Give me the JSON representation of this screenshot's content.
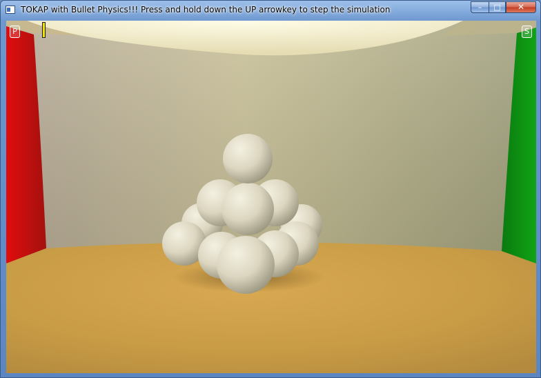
{
  "window": {
    "title": "TOKAP with Bullet Physics!!! Press and hold down the UP arrowkey to step the simulation",
    "icon": "app-window-icon",
    "controls": {
      "minimize_icon": "minimize-icon",
      "maximize_icon": "maximize-icon",
      "close_icon": "close-icon"
    }
  },
  "hud": {
    "left_label": "P",
    "right_label": "S"
  },
  "scene": {
    "left_wall_color": "#d20f0c",
    "right_wall_color": "#109a12",
    "back_wall_color": "#a8a28c",
    "floor_color": "#c89f48",
    "light_color": "#fffbe0",
    "sphere_color": "#e4e0ce"
  }
}
